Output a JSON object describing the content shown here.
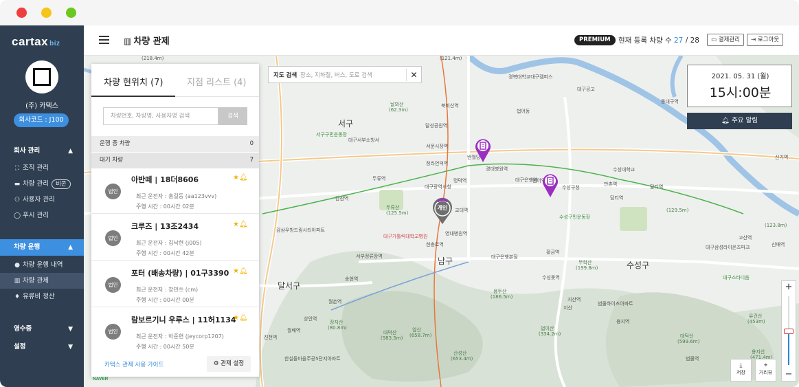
{
  "sidebar": {
    "logo_main": "cartax",
    "logo_sub": "biz",
    "company": "(주) 카텍스",
    "company_code": "회사코드 : J100",
    "groups": {
      "company_mgmt": "회사 관리",
      "vehicle_ops": "차량 운행",
      "receipts": "영수증",
      "settings": "설정"
    },
    "items": {
      "org": "조직 관리",
      "vehicle": "차량 관리",
      "vehicle_tag": "비콘",
      "users": "사용자 관리",
      "push": "푸시 관리",
      "history": "차량 운행 내역",
      "control": "차량 관제",
      "fuel": "유류비 정산"
    }
  },
  "header": {
    "title": "차량 관제",
    "premium": "PREMIUM",
    "count_label": "현재 등록 차량 수",
    "count_current": "27",
    "count_sep": " / ",
    "count_total": "28",
    "billing": "결제관리",
    "logout": "로그아웃"
  },
  "panel": {
    "tab_location": "차량 현위치 (7)",
    "tab_branches": "지점 리스트 (4)",
    "search_placeholder": "차량번호, 차량명, 사용자명 검색",
    "search_button": "검색",
    "running_label": "운행 중 차량",
    "running_count": "0",
    "waiting_label": "대기 차량",
    "waiting_count": "7",
    "vehicles": [
      {
        "badge": "법인",
        "name": "아반떼 | 18더8606",
        "driver": "최근 운전자 : 홍길동 (aa123vvv)",
        "time": "주행 시간 : 00시간 02분"
      },
      {
        "badge": "법인",
        "name": "크루즈 | 13조2434",
        "driver": "최근 운전자 : 김낙현 (j005)",
        "time": "주행 시간 : 00시간 42분"
      },
      {
        "badge": "법인",
        "name": "포터 (배송차량) | 01구3390",
        "driver": "최근 운전자 : 창민쓰 (cm)",
        "time": "주행 시간 : 00시간 00분"
      },
      {
        "badge": "법인",
        "name": "람보르기니 우루스 | 11허1134",
        "driver": "최근 운전자 : 박준현 (jeycorp1207)",
        "time": "주행 시간 : 00시간 50분"
      }
    ],
    "guide_link": "카택스 관제 사용 가이드",
    "settings_button": "관제 설정"
  },
  "map": {
    "search_label": "지도 검색",
    "search_placeholder": "장소, 지하철, 버스, 도로 검색",
    "date": "2021. 05. 31 (월)",
    "time": "15시:00분",
    "alert_button": "주요 알림",
    "save_label": "저장",
    "distance_label": "거리뷰",
    "pin_label": "개인",
    "attribution": "NAVER",
    "labels": {
      "seo_gu": "서구",
      "nam_gu": "남구",
      "dalseo": "달서구",
      "suseong": "수성구"
    },
    "small_labels": [
      "(218.4m)",
      "(121.4m)",
      "날뫼산",
      "(62.3m)",
      "서구구민운동장",
      "대구서부소방서",
      "북비산역",
      "달성공원역",
      "서문시장역",
      "청라언덕역",
      "반월당역",
      "경대병원역",
      "대구은행역",
      "수성구청",
      "만촌역",
      "담티역",
      "대구광역시청",
      "감삼역",
      "두류산",
      "(125.5m)",
      "감삼우방드림시티아파트",
      "대구가톨릭대학교병원",
      "교대역",
      "명덕역",
      "현충로역",
      "영대병원역",
      "서부정류장역",
      "수성구민운동장",
      "황금역",
      "대구은행본점",
      "범어역",
      "(129.5m)",
      "(123.8m)",
      "신매역",
      "고산역",
      "무학산",
      "(199.8m)",
      "수성못역",
      "지산역",
      "범물하이츠아파트",
      "용지역",
      "대덕산",
      "(583.5m)",
      "앞산",
      "(658.7m)",
      "산성산",
      "(653.4m)",
      "법이산",
      "(334.2m)",
      "유건산",
      "(453m)",
      "대덕산",
      "(599.6m)",
      "송현역",
      "월촌역",
      "상인역",
      "장자산",
      "(80.8m)",
      "월배역",
      "진천역",
      "한실들마을주공5단지아파트",
      "동대구역",
      "신기역",
      "경북대학교대구캠퍼스",
      "대구공고",
      "달티역",
      "용지산",
      "(471.4m)",
      "범물역",
      "두류역",
      "수성대학교",
      "법어동",
      "대구삼성라이온즈파크",
      "대구스타디움",
      "지산",
      "용두산",
      "(186.5m)"
    ]
  }
}
